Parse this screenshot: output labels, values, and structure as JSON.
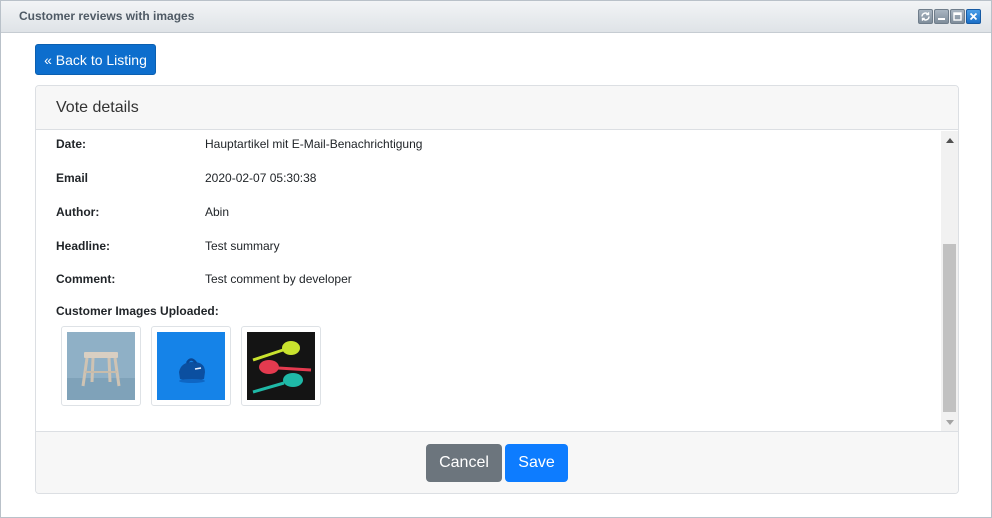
{
  "window": {
    "title": "Customer reviews with images",
    "controls": [
      "refresh-icon",
      "minimize-icon",
      "maximize-icon",
      "close-icon"
    ]
  },
  "back_button": {
    "label": "« Back to Listing"
  },
  "card": {
    "title": "Vote details",
    "fields": [
      {
        "label": "Date:",
        "value": "Hauptartikel mit E-Mail-Benachrichtigung"
      },
      {
        "label": "Email",
        "value": "2020-02-07 05:30:38"
      },
      {
        "label": "Author:",
        "value": "Abin"
      },
      {
        "label": "Headline:",
        "value": "Test summary"
      },
      {
        "label": "Comment:",
        "value": "Test comment by developer"
      }
    ],
    "images_label": "Customer Images Uploaded:",
    "images": [
      "stool-photo",
      "blue-bag-photo",
      "colorful-spoons-photo"
    ]
  },
  "footer": {
    "cancel_label": "Cancel",
    "save_label": "Save"
  },
  "colors": {
    "primary": "#0d6ecd",
    "save": "#0d7cff",
    "cancel": "#6c757d"
  }
}
